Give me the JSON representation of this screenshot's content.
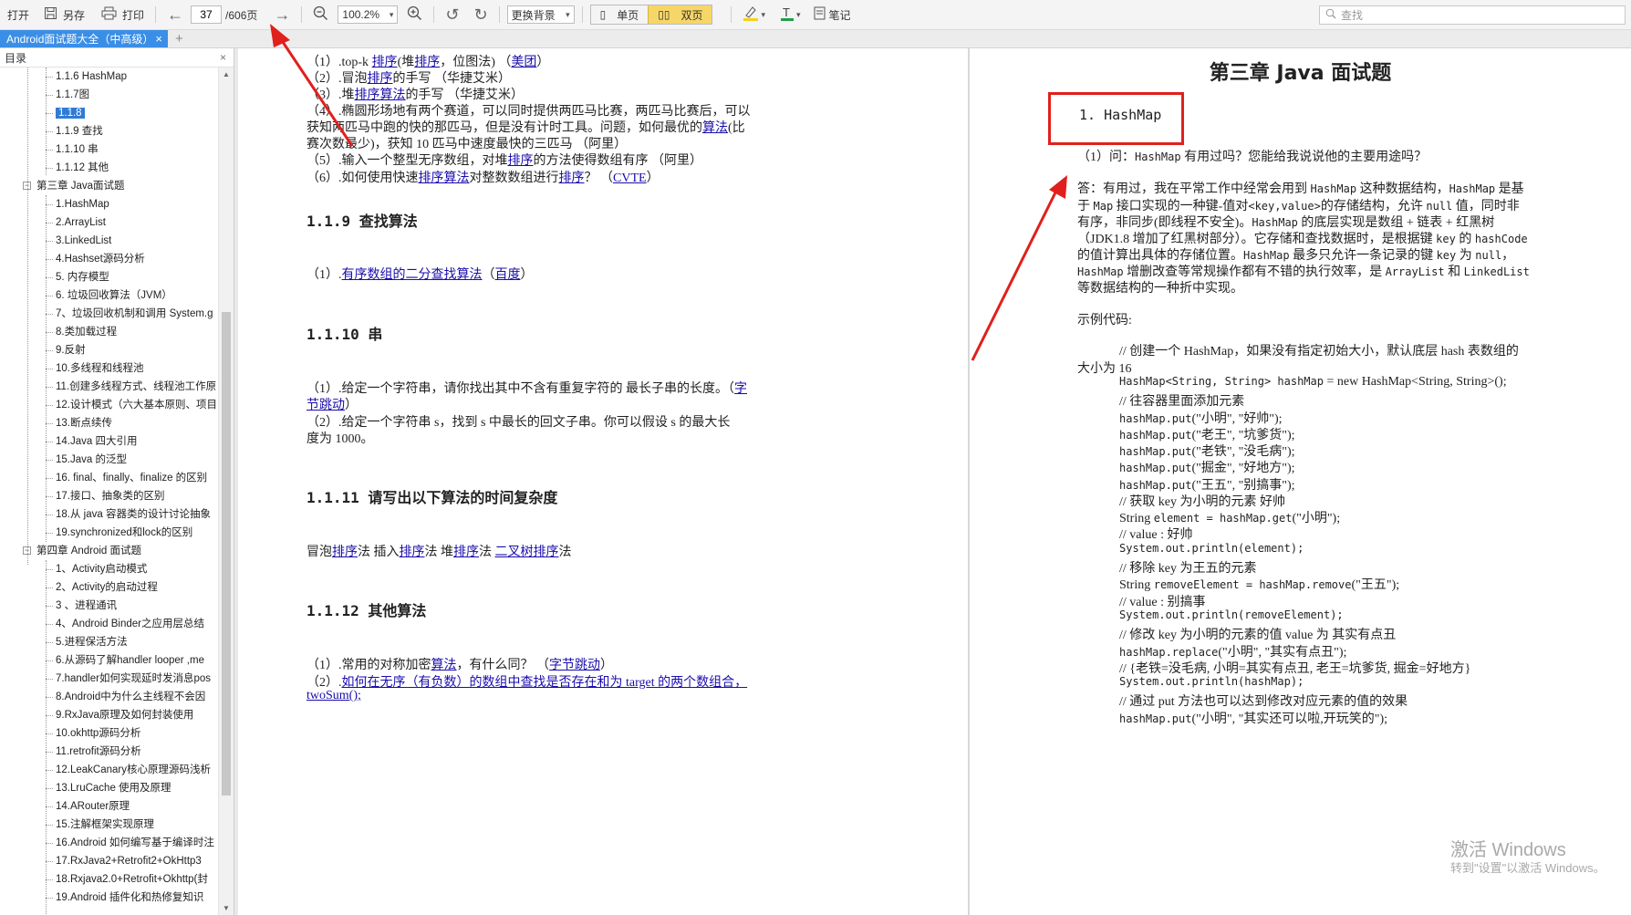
{
  "toolbar": {
    "open": "打开",
    "save_as": "另存",
    "print": "打印",
    "page_current": "37",
    "page_total": "/606页",
    "zoom": "100.2%",
    "background": "更换背景",
    "single_page": "单页",
    "double_page": "双页",
    "notes": "笔记",
    "search_placeholder": "查找"
  },
  "tab": {
    "title": "Android面试题大全（中高级）",
    "close": "×",
    "add": "+"
  },
  "sidebar": {
    "title": "目录",
    "close": "×",
    "items": [
      {
        "label": "1.1.6 HashMap",
        "level": 2
      },
      {
        "label": "1.1.7图",
        "level": 2
      },
      {
        "label": "1.1.8",
        "level": 2,
        "selected": true
      },
      {
        "label": "1.1.9 查找",
        "level": 2
      },
      {
        "label": "1.1.10 串",
        "level": 2
      },
      {
        "label": "1.1.12 其他",
        "level": 2
      },
      {
        "label": "第三章 Java面试题",
        "level": 1
      },
      {
        "label": "1.HashMap",
        "level": 2
      },
      {
        "label": "2.ArrayList",
        "level": 2
      },
      {
        "label": "3.LinkedList",
        "level": 2
      },
      {
        "label": "4.Hashset源码分析",
        "level": 2
      },
      {
        "label": "5. 内存模型",
        "level": 2
      },
      {
        "label": "6. 垃圾回收算法（JVM）",
        "level": 2
      },
      {
        "label": "7、垃圾回收机制和调用 System.g",
        "level": 2
      },
      {
        "label": "8.类加载过程",
        "level": 2
      },
      {
        "label": "9.反射",
        "level": 2
      },
      {
        "label": "10.多线程和线程池",
        "level": 2
      },
      {
        "label": "11.创建多线程方式、线程池工作原",
        "level": 2
      },
      {
        "label": "12.设计模式（六大基本原则、项目",
        "level": 2
      },
      {
        "label": "13.断点续传",
        "level": 2
      },
      {
        "label": "14.Java 四大引用",
        "level": 2
      },
      {
        "label": "15.Java 的泛型",
        "level": 2
      },
      {
        "label": "16. final、finally、finalize 的区别",
        "level": 2
      },
      {
        "label": "17.接口、抽象类的区别",
        "level": 2
      },
      {
        "label": "18.从 java 容器类的设计讨论抽象",
        "level": 2
      },
      {
        "label": "19.synchronized和lock的区别",
        "level": 2
      },
      {
        "label": "第四章 Android 面试题",
        "level": 1
      },
      {
        "label": "1、Activity启动模式",
        "level": 2
      },
      {
        "label": "2、Activity的启动过程",
        "level": 2
      },
      {
        "label": "3 、进程通讯",
        "level": 2
      },
      {
        "label": "4、Android Binder之应用层总结",
        "level": 2
      },
      {
        "label": "5.进程保活方法",
        "level": 2
      },
      {
        "label": "6.从源码了解handler looper ,me",
        "level": 2
      },
      {
        "label": "7.handler如何实现延时发消息pos",
        "level": 2
      },
      {
        "label": "8.Android中为什么主线程不会因",
        "level": 2
      },
      {
        "label": "9.RxJava原理及如何封装使用",
        "level": 2
      },
      {
        "label": "10.okhttp源码分析",
        "level": 2
      },
      {
        "label": "11.retrofit源码分析",
        "level": 2
      },
      {
        "label": "12.LeakCanary核心原理源码浅析",
        "level": 2
      },
      {
        "label": "13.LruCache 使用及原理",
        "level": 2
      },
      {
        "label": "14.ARouter原理",
        "level": 2
      },
      {
        "label": "15.注解框架实现原理",
        "level": 2
      },
      {
        "label": "16.Android 如何编写基于编译时注",
        "level": 2
      },
      {
        "label": "17.RxJava2+Retrofit2+OkHttp3",
        "level": 2
      },
      {
        "label": "18.Rxjava2.0+Retrofit+Okhttp(封",
        "level": 2
      },
      {
        "label": "19.Android 插件化和热修复知识",
        "level": 2
      }
    ]
  },
  "left_page": {
    "l1": {
      "a": "（1）.top-k ",
      "b": "排序",
      "c": "(堆",
      "d": "排序",
      "e": "，位图法) （",
      "f": "美团",
      "g": "）"
    },
    "l2": {
      "a": "（2）.冒泡",
      "b": "排序",
      "c": "的手写 （华捷艾米）"
    },
    "l3": {
      "a": "（3）.堆",
      "b": "排序算法",
      "c": "的手写 （华捷艾米）"
    },
    "l4a": "（4）.椭圆形场地有两个赛道，可以同时提供两匹马比赛，两匹马比赛后，可以",
    "l4b": {
      "a": "获知两匹马中跑的快的那匹马，但是没有计时工具。问题，如何最优的",
      "b": "算法",
      "c": "(比"
    },
    "l4c": "赛次数最少)，获知 10 匹马中速度最快的三匹马 （阿里）",
    "l5": {
      "a": "（5）.输入一个整型无序数组，对堆",
      "b": "排序",
      "c": "的方法使得数组有序 （阿里）"
    },
    "l6": {
      "a": "（6）.如何使用快速",
      "b": "排序算法",
      "c": "对整数数组进行",
      "d": "排序",
      "e": "？ （",
      "f": "CVTE",
      "g": "）"
    },
    "h119": "1.1.9 查找算法",
    "s119": {
      "a": "（1）.",
      "b": "有序数组的二分查找算法",
      "c": "（",
      "d": "百度",
      "e": "）"
    },
    "h1110": "1.1.10 串",
    "s1110a": {
      "a": "（1）.给定一个字符串，请你找出其中不含有重复字符的 最长子串的长度。（",
      "b": "字"
    },
    "s1110b": {
      "a": "节跳动",
      "b": "）"
    },
    "s1110c": "（2）.给定一个字符串 s，找到 s 中最长的回文子串。你可以假设 s 的最大长",
    "s1110d": "度为 1000。",
    "h1111": "1.1.11 请写出以下算法的时间复杂度",
    "s1111": {
      "a": "冒泡",
      "b": "排序",
      "c": "法 插入",
      "d": "排序",
      "e": "法 堆",
      "f": "排序",
      "g": "法 ",
      "h": "二叉树排序",
      "i": "法"
    },
    "h1112": "1.1.12 其他算法",
    "s1112a": {
      "a": "（1）.常用的对称加密",
      "b": "算法",
      "c": "，有什么同？ （",
      "d": "字节跳动",
      "e": "）"
    },
    "s1112b": {
      "a": "（2）.",
      "b": "如何在无序（有负数）的数组中查找是否存在和为 target 的两个数组合，"
    },
    "s1112c": "twoSum();"
  },
  "right_page": {
    "chapter": "第三章 Java 面试题",
    "section": "1. HashMap",
    "q": {
      "a": "（1）问：",
      "b": "HashMap",
      "c": " 有用过吗？您能给我说说他的主要用途吗？"
    },
    "a1": {
      "a": "答：有用过，我在平常工作中经常会用到 ",
      "b": "HashMap",
      "c": " 这种数据结构，",
      "d": "HashMap",
      "e": " 是基"
    },
    "a2": {
      "a": "于 ",
      "b": "Map",
      "c": " 接口实现的一种键-值对",
      "d": "<key,value>",
      "e": "的存储结构，允许 ",
      "f": "null",
      "g": " 值，同时非"
    },
    "a3": {
      "a": "有序，非同步(即线程不安全)。",
      "b": "HashMap",
      "c": " 的底层实现是数组 + 链表 + 红黑树"
    },
    "a4": {
      "a": "（JDK1.8 增加了红黑树部分）。它存储和查找数据时，是根据键 ",
      "b": "key",
      "c": " 的 ",
      "d": "hashCode"
    },
    "a5": {
      "a": "的值计算出具体的存储位置。",
      "b": "HashMap",
      "c": " 最多只允许一条记录的键 ",
      "d": "key",
      "e": " 为 ",
      "f": "null",
      "g": "，"
    },
    "a6": {
      "a": "HashMap",
      "b": " 增删改查等常规操作都有不错的执行效率，是 ",
      "c": "ArrayList",
      "d": " 和 ",
      "e": "LinkedList"
    },
    "a7": "等数据结构的一种折中实现。",
    "example": "示例代码:",
    "c1": "// 创建一个 HashMap，如果没有指定初始大小，默认底层 hash 表数组的",
    "c1b": "大小为 16",
    "c2": {
      "a": "HashMap<String, String> hashMap",
      "b": " = new HashMap<String, String>();"
    },
    "c3": "// 往容器里面添加元素",
    "c4": {
      "a": "hashMap.put",
      "b": "(\"小明\", \"好帅\");"
    },
    "c5": {
      "a": "hashMap.put",
      "b": "(\"老王\", \"坑爹货\");"
    },
    "c6": {
      "a": "hashMap.put",
      "b": "(\"老铁\", \"没毛病\");"
    },
    "c7": {
      "a": "hashMap.put",
      "b": "(\"掘金\", \"好地方\");"
    },
    "c8": {
      "a": "hashMap.put",
      "b": "(\"王五\", \"别搞事\");"
    },
    "c9": "// 获取 key 为小明的元素 好帅",
    "c10": {
      "a": "String ",
      "b": "element = hashMap.get",
      "c": "(\"小明\");"
    },
    "c11": "// value : 好帅",
    "c12": {
      "a": "System.out.println",
      "b": "(element);"
    },
    "c13": "// 移除 key 为王五的元素",
    "c14": {
      "a": "String ",
      "b": "removeElement = hashMap.remove",
      "c": "(\"王五\");"
    },
    "c15": "// value : 别搞事",
    "c16": {
      "a": "System.out.println",
      "b": "(removeElement);"
    },
    "c17": "// 修改 key 为小明的元素的值 value 为 其实有点丑",
    "c18": {
      "a": "hashMap.replace",
      "b": "(\"小明\", \"其实有点丑\");"
    },
    "c19": "// {老铁=没毛病, 小明=其实有点丑, 老王=坑爹货, 掘金=好地方}",
    "c20": {
      "a": "System.out.println",
      "b": "(hashMap);"
    },
    "c21": "// 通过 put 方法也可以达到修改对应元素的值的效果",
    "c22": {
      "a": "hashMap.put",
      "b": "(\"小明\", \"其实还可以啦,开玩笑的\");"
    }
  },
  "watermark": {
    "line1": "激活 Windows",
    "line2": "转到\"设置\"以激活 Windows。"
  },
  "colors": {
    "accent": "#3a8ee6",
    "link": "#1a0dab",
    "annotation_red": "#e0201c",
    "toggle_on": "#f7d669"
  }
}
